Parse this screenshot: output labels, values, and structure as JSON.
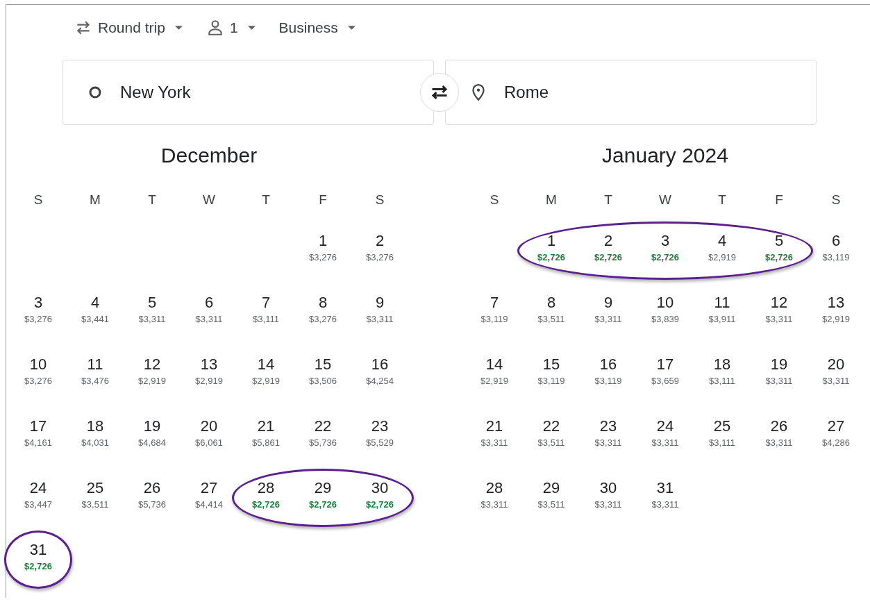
{
  "trip_options": [
    {
      "kind": "trip_type",
      "label": "Round trip"
    },
    {
      "kind": "passengers",
      "label": "1"
    },
    {
      "kind": "cabin",
      "label": "Business"
    }
  ],
  "origin": {
    "value": "New York"
  },
  "destination": {
    "value": "Rome"
  },
  "months": [
    {
      "title": "December",
      "weekdays": [
        "S",
        "M",
        "T",
        "W",
        "T",
        "F",
        "S"
      ],
      "weeks": [
        [
          {
            "day": "1",
            "price": "$3,276",
            "cheap": false,
            "circled": false
          },
          {
            "day": "2",
            "price": "$3,276",
            "cheap": false,
            "circled": false
          }
        ],
        [
          {
            "day": "3",
            "price": "$3,276",
            "cheap": false,
            "circled": false
          },
          {
            "day": "4",
            "price": "$3,441",
            "cheap": false,
            "circled": false
          },
          {
            "day": "5",
            "price": "$3,311",
            "cheap": false,
            "circled": false
          },
          {
            "day": "6",
            "price": "$3,311",
            "cheap": false,
            "circled": false
          },
          {
            "day": "7",
            "price": "$3,111",
            "cheap": false,
            "circled": false
          },
          {
            "day": "8",
            "price": "$3,276",
            "cheap": false,
            "circled": false
          },
          {
            "day": "9",
            "price": "$3,311",
            "cheap": false,
            "circled": false
          }
        ],
        [
          {
            "day": "10",
            "price": "$3,276",
            "cheap": false,
            "circled": false
          },
          {
            "day": "11",
            "price": "$3,476",
            "cheap": false,
            "circled": false
          },
          {
            "day": "12",
            "price": "$2,919",
            "cheap": false,
            "circled": false
          },
          {
            "day": "13",
            "price": "$2,919",
            "cheap": false,
            "circled": false
          },
          {
            "day": "14",
            "price": "$2,919",
            "cheap": false,
            "circled": false
          },
          {
            "day": "15",
            "price": "$3,506",
            "cheap": false,
            "circled": false
          },
          {
            "day": "16",
            "price": "$4,254",
            "cheap": false,
            "circled": false
          }
        ],
        [
          {
            "day": "17",
            "price": "$4,161",
            "cheap": false,
            "circled": false
          },
          {
            "day": "18",
            "price": "$4,031",
            "cheap": false,
            "circled": false
          },
          {
            "day": "19",
            "price": "$4,684",
            "cheap": false,
            "circled": false
          },
          {
            "day": "20",
            "price": "$6,061",
            "cheap": false,
            "circled": false
          },
          {
            "day": "21",
            "price": "$5,861",
            "cheap": false,
            "circled": false
          },
          {
            "day": "22",
            "price": "$5,736",
            "cheap": false,
            "circled": false
          },
          {
            "day": "23",
            "price": "$5,529",
            "cheap": false,
            "circled": false
          }
        ],
        [
          {
            "day": "24",
            "price": "$3,447",
            "cheap": false,
            "circled": false
          },
          {
            "day": "25",
            "price": "$3,511",
            "cheap": false,
            "circled": false
          },
          {
            "day": "26",
            "price": "$5,736",
            "cheap": false,
            "circled": false
          },
          {
            "day": "27",
            "price": "$4,414",
            "cheap": false,
            "circled": false
          },
          {
            "day": "28",
            "price": "$2,726",
            "cheap": true,
            "circled": true
          },
          {
            "day": "29",
            "price": "$2,726",
            "cheap": true,
            "circled": true
          },
          {
            "day": "30",
            "price": "$2,726",
            "cheap": true,
            "circled": true
          }
        ],
        [
          {
            "day": "31",
            "price": "$2,726",
            "cheap": true,
            "circled": true
          }
        ]
      ]
    },
    {
      "title": "January 2024",
      "weekdays": [
        "S",
        "M",
        "T",
        "W",
        "T",
        "F",
        "S"
      ],
      "weeks": [
        [
          {
            "day": "1",
            "price": "$2,726",
            "cheap": true,
            "circled": true
          },
          {
            "day": "2",
            "price": "$2,726",
            "cheap": true,
            "circled": true
          },
          {
            "day": "3",
            "price": "$2,726",
            "cheap": true,
            "circled": true
          },
          {
            "day": "4",
            "price": "$2,919",
            "cheap": false,
            "circled": true
          },
          {
            "day": "5",
            "price": "$2,726",
            "cheap": true,
            "circled": true
          },
          {
            "day": "6",
            "price": "$3,119",
            "cheap": false,
            "circled": false
          }
        ],
        [
          {
            "day": "7",
            "price": "$3,119",
            "cheap": false,
            "circled": false
          },
          {
            "day": "8",
            "price": "$3,511",
            "cheap": false,
            "circled": false
          },
          {
            "day": "9",
            "price": "$3,311",
            "cheap": false,
            "circled": false
          },
          {
            "day": "10",
            "price": "$3,839",
            "cheap": false,
            "circled": false
          },
          {
            "day": "11",
            "price": "$3,911",
            "cheap": false,
            "circled": false
          },
          {
            "day": "12",
            "price": "$3,311",
            "cheap": false,
            "circled": false
          },
          {
            "day": "13",
            "price": "$2,919",
            "cheap": false,
            "circled": false
          }
        ],
        [
          {
            "day": "14",
            "price": "$2,919",
            "cheap": false,
            "circled": false
          },
          {
            "day": "15",
            "price": "$3,119",
            "cheap": false,
            "circled": false
          },
          {
            "day": "16",
            "price": "$3,119",
            "cheap": false,
            "circled": false
          },
          {
            "day": "17",
            "price": "$3,659",
            "cheap": false,
            "circled": false
          },
          {
            "day": "18",
            "price": "$3,111",
            "cheap": false,
            "circled": false
          },
          {
            "day": "19",
            "price": "$3,311",
            "cheap": false,
            "circled": false
          },
          {
            "day": "20",
            "price": "$3,311",
            "cheap": false,
            "circled": false
          }
        ],
        [
          {
            "day": "21",
            "price": "$3,311",
            "cheap": false,
            "circled": false
          },
          {
            "day": "22",
            "price": "$3,511",
            "cheap": false,
            "circled": false
          },
          {
            "day": "23",
            "price": "$3,311",
            "cheap": false,
            "circled": false
          },
          {
            "day": "24",
            "price": "$3,311",
            "cheap": false,
            "circled": false
          },
          {
            "day": "25",
            "price": "$3,111",
            "cheap": false,
            "circled": false
          },
          {
            "day": "26",
            "price": "$3,311",
            "cheap": false,
            "circled": false
          },
          {
            "day": "27",
            "price": "$4,286",
            "cheap": false,
            "circled": false
          }
        ],
        [
          {
            "day": "28",
            "price": "$3,311",
            "cheap": false,
            "circled": false
          },
          {
            "day": "29",
            "price": "$3,511",
            "cheap": false,
            "circled": false
          },
          {
            "day": "30",
            "price": "$3,311",
            "cheap": false,
            "circled": false
          },
          {
            "day": "31",
            "price": "$3,311",
            "cheap": false,
            "circled": false
          }
        ]
      ]
    }
  ]
}
